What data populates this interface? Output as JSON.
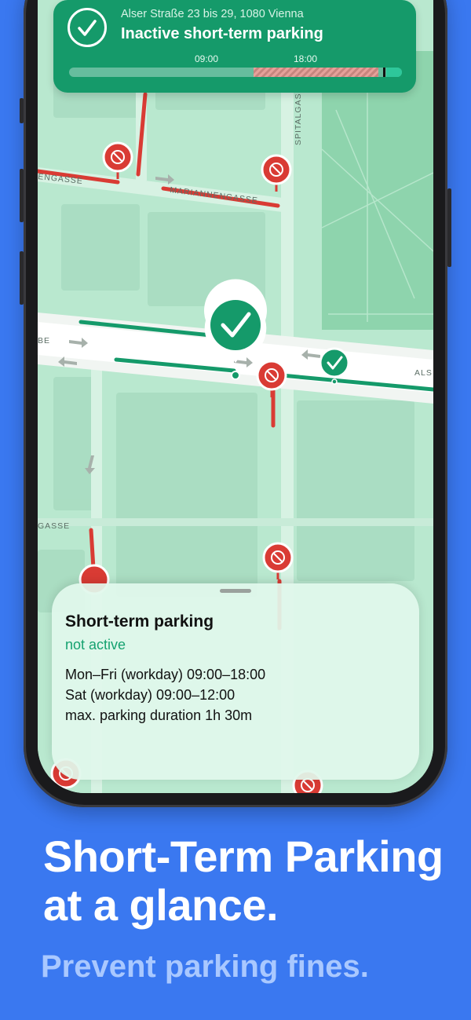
{
  "status_card": {
    "address": "Alser Straße 23 bis 29, 1080 Vienna",
    "title": "Inactive short-term parking",
    "timeline_start_label": "09:00",
    "timeline_end_label": "18:00",
    "restricted_window": {
      "start": "09:00",
      "end": "18:00"
    }
  },
  "map": {
    "streets": {
      "westgasse": "ENGASSE",
      "mariannengasse": "MARIANNENGASSE",
      "spitalgasse": "SPITALGASSE",
      "alser_left": "BE",
      "alser_right": "ALS",
      "lower_left": "GASSE"
    },
    "colors": {
      "allowed": "#159a6a",
      "restricted": "#d93b34",
      "park": "#8ed4ad",
      "map_base": "#b9e8cf"
    }
  },
  "sheet": {
    "title": "Short-term parking",
    "status": "not active",
    "line1": "Mon–Fri (workday) 09:00–18:00",
    "line2": "Sat (workday) 09:00–12:00",
    "line3": "max. parking duration 1h 30m"
  },
  "marketing": {
    "headline_line1": "Short-Term Parking",
    "headline_line2": "at a glance.",
    "subheadline": "Prevent parking fines."
  }
}
